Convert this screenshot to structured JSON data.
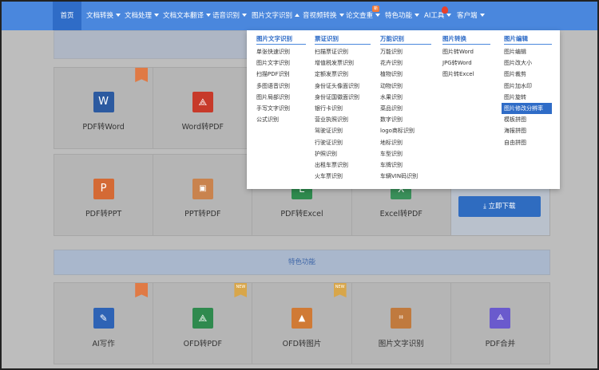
{
  "nav": {
    "items": [
      {
        "label": "首页",
        "caret": false
      },
      {
        "label": "文档转换",
        "caret": true
      },
      {
        "label": "文档处理",
        "caret": true
      },
      {
        "label": "文档文本翻译",
        "caret": true
      },
      {
        "label": "语音识别",
        "caret": true
      },
      {
        "label": "图片文字识别",
        "caret": true
      },
      {
        "label": "音视频转换",
        "caret": true
      },
      {
        "label": "论文查重",
        "caret": true
      },
      {
        "label": "特色功能",
        "caret": true
      },
      {
        "label": "AI工具",
        "caret": true
      },
      {
        "label": "客户端",
        "caret": true
      }
    ],
    "new_badge": "新"
  },
  "dropdown": {
    "columns": [
      {
        "head": "图片文字识别",
        "items": [
          "单张快速识别",
          "图片文字识别",
          "扫描PDF识别",
          "多图语音识别",
          "图片局部识别",
          "手写文字识别",
          "公式识别"
        ]
      },
      {
        "head": "票证识别",
        "items": [
          "扫描票证识别",
          "增值税发票识别",
          "定额发票识别",
          "身份证头像面识别",
          "身份证国徽面识别",
          "银行卡识别",
          "营业执照识别",
          "驾驶证识别",
          "行驶证识别",
          "护照识别",
          "出租车票识别",
          "火车票识别"
        ]
      },
      {
        "head": "万能识别",
        "items": [
          "万能识别",
          "花卉识别",
          "植物识别",
          "动物识别",
          "水果识别",
          "菜品识别",
          "数字识别",
          "logo商标识别",
          "地标识别",
          "车型识别",
          "车牌识别",
          "车辆VIN码识别"
        ]
      },
      {
        "head": "图片转换",
        "items": [
          "图片转Word",
          "JPG转Word",
          "图片转Excel"
        ]
      },
      {
        "head": "图片编辑",
        "items": [
          "图片编辑",
          "图片改大小",
          "图片裁剪",
          "图片加水印",
          "图片旋转",
          "图片修改分辨率",
          "模板拼图",
          "海报拼图",
          "自由拼图"
        ]
      }
    ]
  },
  "tools_row1": [
    "PDF转Word",
    "Word转PDF"
  ],
  "tools_row2": [
    "PDF转PPT",
    "PPT转PDF",
    "PDF转Excel",
    "Excel转PDF"
  ],
  "download_label": "立即下载",
  "section_title": "特色功能",
  "tools_row3": [
    "AI写作",
    "OFD转PDF",
    "OFD转图片",
    "图片文字识别",
    "PDF合并"
  ],
  "new_tag": "NEW"
}
